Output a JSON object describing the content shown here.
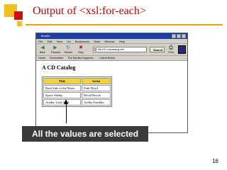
{
  "slide": {
    "title": "Output of <xsl:for-each>",
    "page_number": "16",
    "callout_text": "All the values are selected",
    "colors": {
      "title": "#cc0000",
      "rule": "#e8a500",
      "callout_bg": "#3a3a3a",
      "square_gold": "#f0c020",
      "square_red": "#cc1111"
    }
  },
  "browser": {
    "window_title": "Mozilla",
    "menu": [
      "File",
      "Edit",
      "View",
      "Go",
      "Bookmarks",
      "Tools",
      "Window",
      "Help"
    ],
    "nav_buttons": [
      {
        "label": "Back",
        "icon": "back-arrow-icon"
      },
      {
        "label": "Forward",
        "icon": "forward-arrow-icon"
      },
      {
        "label": "Reload",
        "icon": "reload-icon"
      },
      {
        "label": "Stop",
        "icon": "stop-icon"
      }
    ],
    "url": "file:///D:/cdcatalog.xml",
    "search_label": "Search",
    "print_label": "Print",
    "bookmarks": [
      "Home",
      "Bookmarks",
      "The Mozilla Organiza...",
      "Latest Builds"
    ]
  },
  "page": {
    "heading": "A CD Catalog",
    "table": {
      "headers": [
        "Title",
        "Artist"
      ],
      "rows": [
        [
          "Dark Side of the Moon",
          "Pink Floyd"
        ],
        [
          "Space Oddity",
          "David Bowie"
        ],
        [
          "Aretha: Lady Soul",
          "Aretha Franklin"
        ]
      ]
    }
  }
}
